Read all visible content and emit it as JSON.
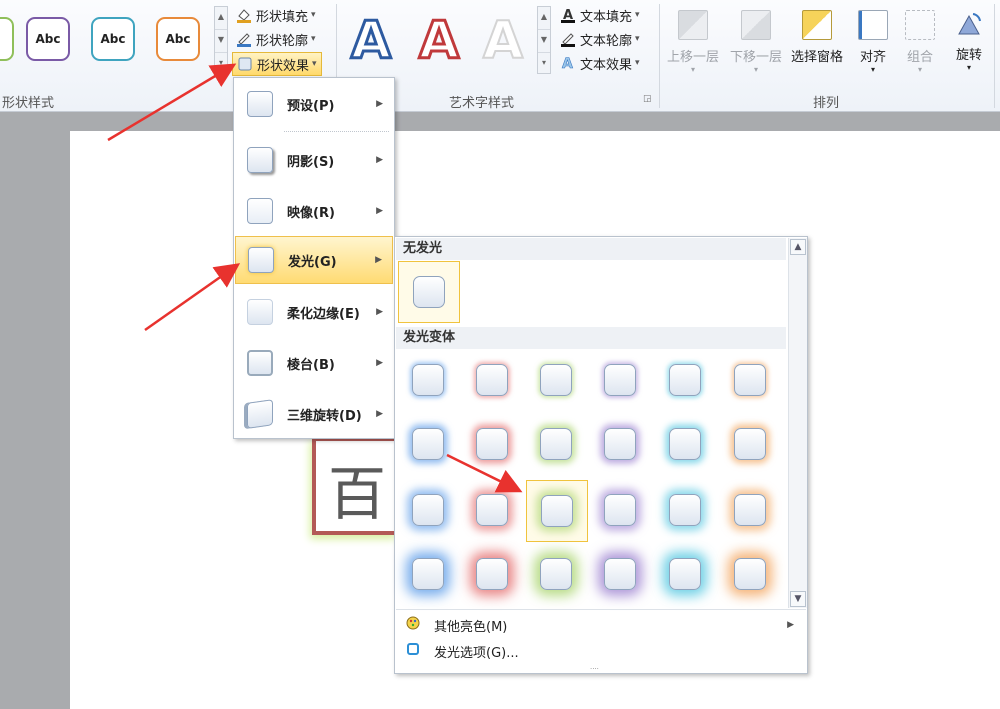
{
  "ribbon": {
    "shape_styles": {
      "label": "形状样式",
      "thumbs": [
        {
          "text": "Abc",
          "color": "#7a5aa6"
        },
        {
          "text": "Abc",
          "color": "#3fa4bf"
        },
        {
          "text": "Abc",
          "color": "#e88a3a"
        }
      ],
      "fill": "形状填充",
      "outline": "形状轮廓",
      "effects": "形状效果"
    },
    "wordart": {
      "label": "艺术字样式",
      "glyph": "A",
      "text_fill": "文本填充",
      "text_outline": "文本轮廓",
      "text_effects": "文本效果"
    },
    "arrange": {
      "label": "排列",
      "bring_forward": "上移一层",
      "send_backward": "下移一层",
      "selection_pane": "选择窗格",
      "align": "对齐",
      "group": "组合",
      "rotate": "旋转"
    }
  },
  "document": {
    "shape_text": "百"
  },
  "effects_menu": {
    "items": [
      {
        "label": "预设(P)"
      },
      {
        "label": "阴影(S)"
      },
      {
        "label": "映像(R)"
      },
      {
        "label": "发光(G)"
      },
      {
        "label": "柔化边缘(E)"
      },
      {
        "label": "棱台(B)"
      },
      {
        "label": "三维旋转(D)"
      }
    ]
  },
  "glow_panel": {
    "no_glow": "无发光",
    "variations": "发光变体",
    "colors": [
      "#5a9be8",
      "#e36a6a",
      "#a8d36a",
      "#9b7fd0",
      "#4fc5e0",
      "#f2a35a"
    ],
    "more_colors": "其他亮色(M)",
    "options": "发光选项(G)..."
  }
}
